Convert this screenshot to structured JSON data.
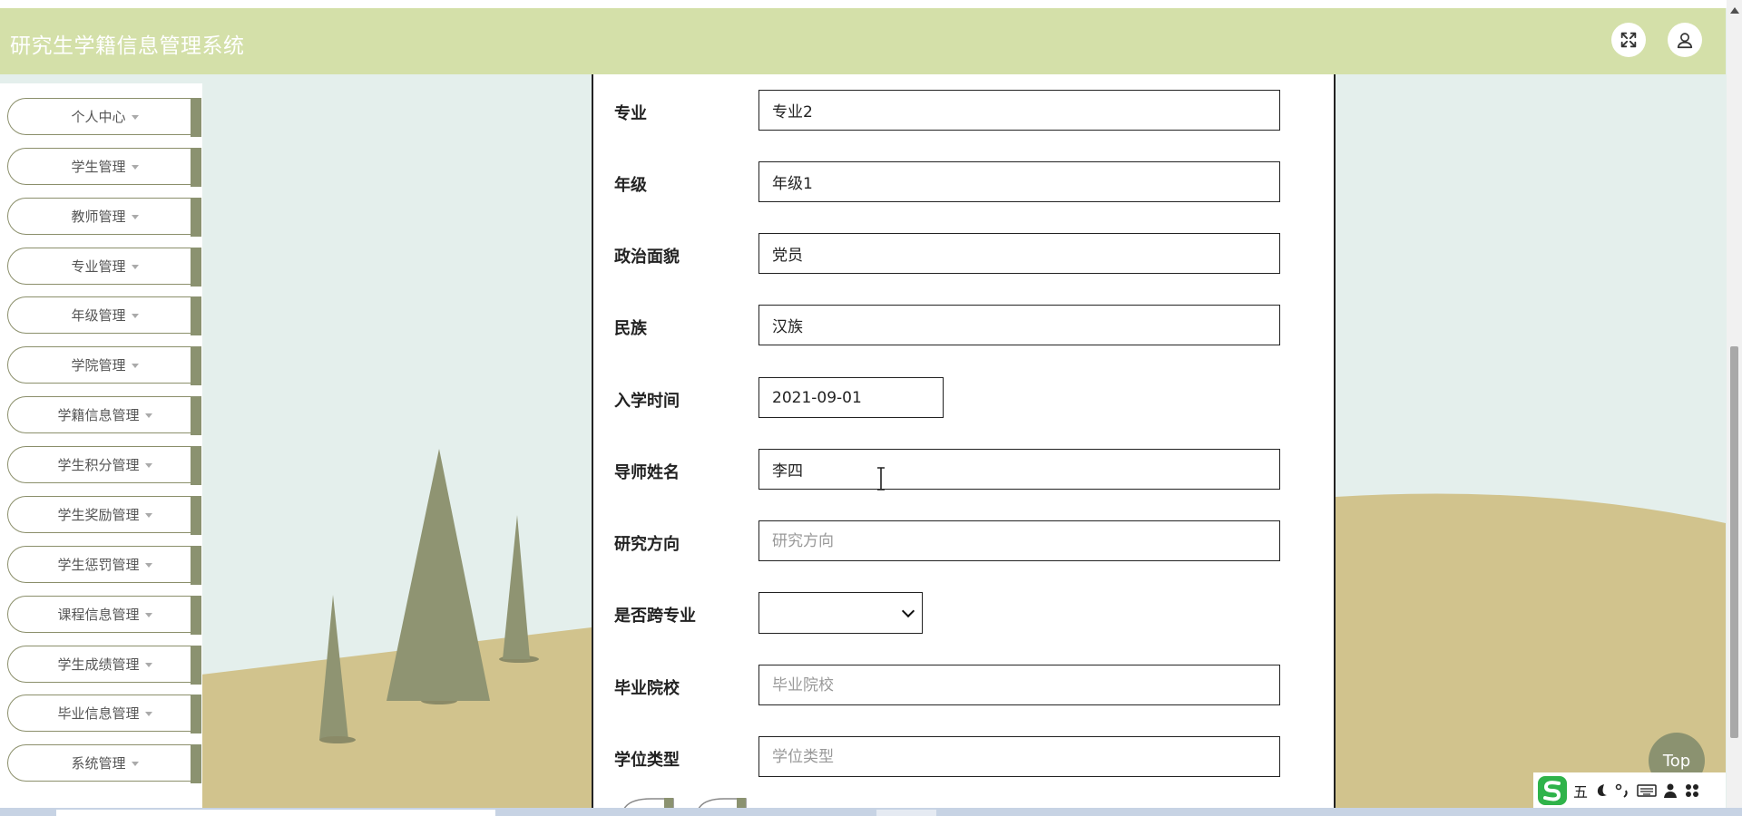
{
  "app": {
    "title": "研究生学籍信息管理系统"
  },
  "header": {
    "buttons": [
      {
        "name": "fullscreen",
        "icon": "expand-arrows-icon"
      },
      {
        "name": "user",
        "icon": "user-icon"
      }
    ]
  },
  "sidebar": {
    "items": [
      {
        "label": "个人中心"
      },
      {
        "label": "学生管理"
      },
      {
        "label": "教师管理"
      },
      {
        "label": "专业管理"
      },
      {
        "label": "年级管理"
      },
      {
        "label": "学院管理"
      },
      {
        "label": "学籍信息管理"
      },
      {
        "label": "学生积分管理"
      },
      {
        "label": "学生奖励管理"
      },
      {
        "label": "学生惩罚管理"
      },
      {
        "label": "课程信息管理"
      },
      {
        "label": "学生成绩管理"
      },
      {
        "label": "毕业信息管理"
      },
      {
        "label": "系统管理"
      }
    ]
  },
  "form": {
    "fields": [
      {
        "label": "专业",
        "value": "专业2",
        "placeholder": ""
      },
      {
        "label": "年级",
        "value": "年级1",
        "placeholder": ""
      },
      {
        "label": "政治面貌",
        "value": "党员",
        "placeholder": ""
      },
      {
        "label": "民族",
        "value": "汉族",
        "placeholder": ""
      },
      {
        "label": "入学时间",
        "value": "2021-09-01",
        "placeholder": ""
      },
      {
        "label": "导师姓名",
        "value": "李四",
        "placeholder": ""
      },
      {
        "label": "研究方向",
        "value": "",
        "placeholder": "研究方向"
      },
      {
        "label": "是否跨专业",
        "value": "",
        "placeholder": ""
      },
      {
        "label": "毕业院校",
        "value": "",
        "placeholder": "毕业院校"
      },
      {
        "label": "学位类型",
        "value": "",
        "placeholder": "学位类型"
      }
    ]
  },
  "top_button": {
    "label": "Top"
  },
  "ime": {
    "mode_label": "五"
  },
  "colors": {
    "header_bg": "#d4e0a9",
    "accent": "#8b9270",
    "background": "#e4efec",
    "ground": "#d1c38d"
  }
}
